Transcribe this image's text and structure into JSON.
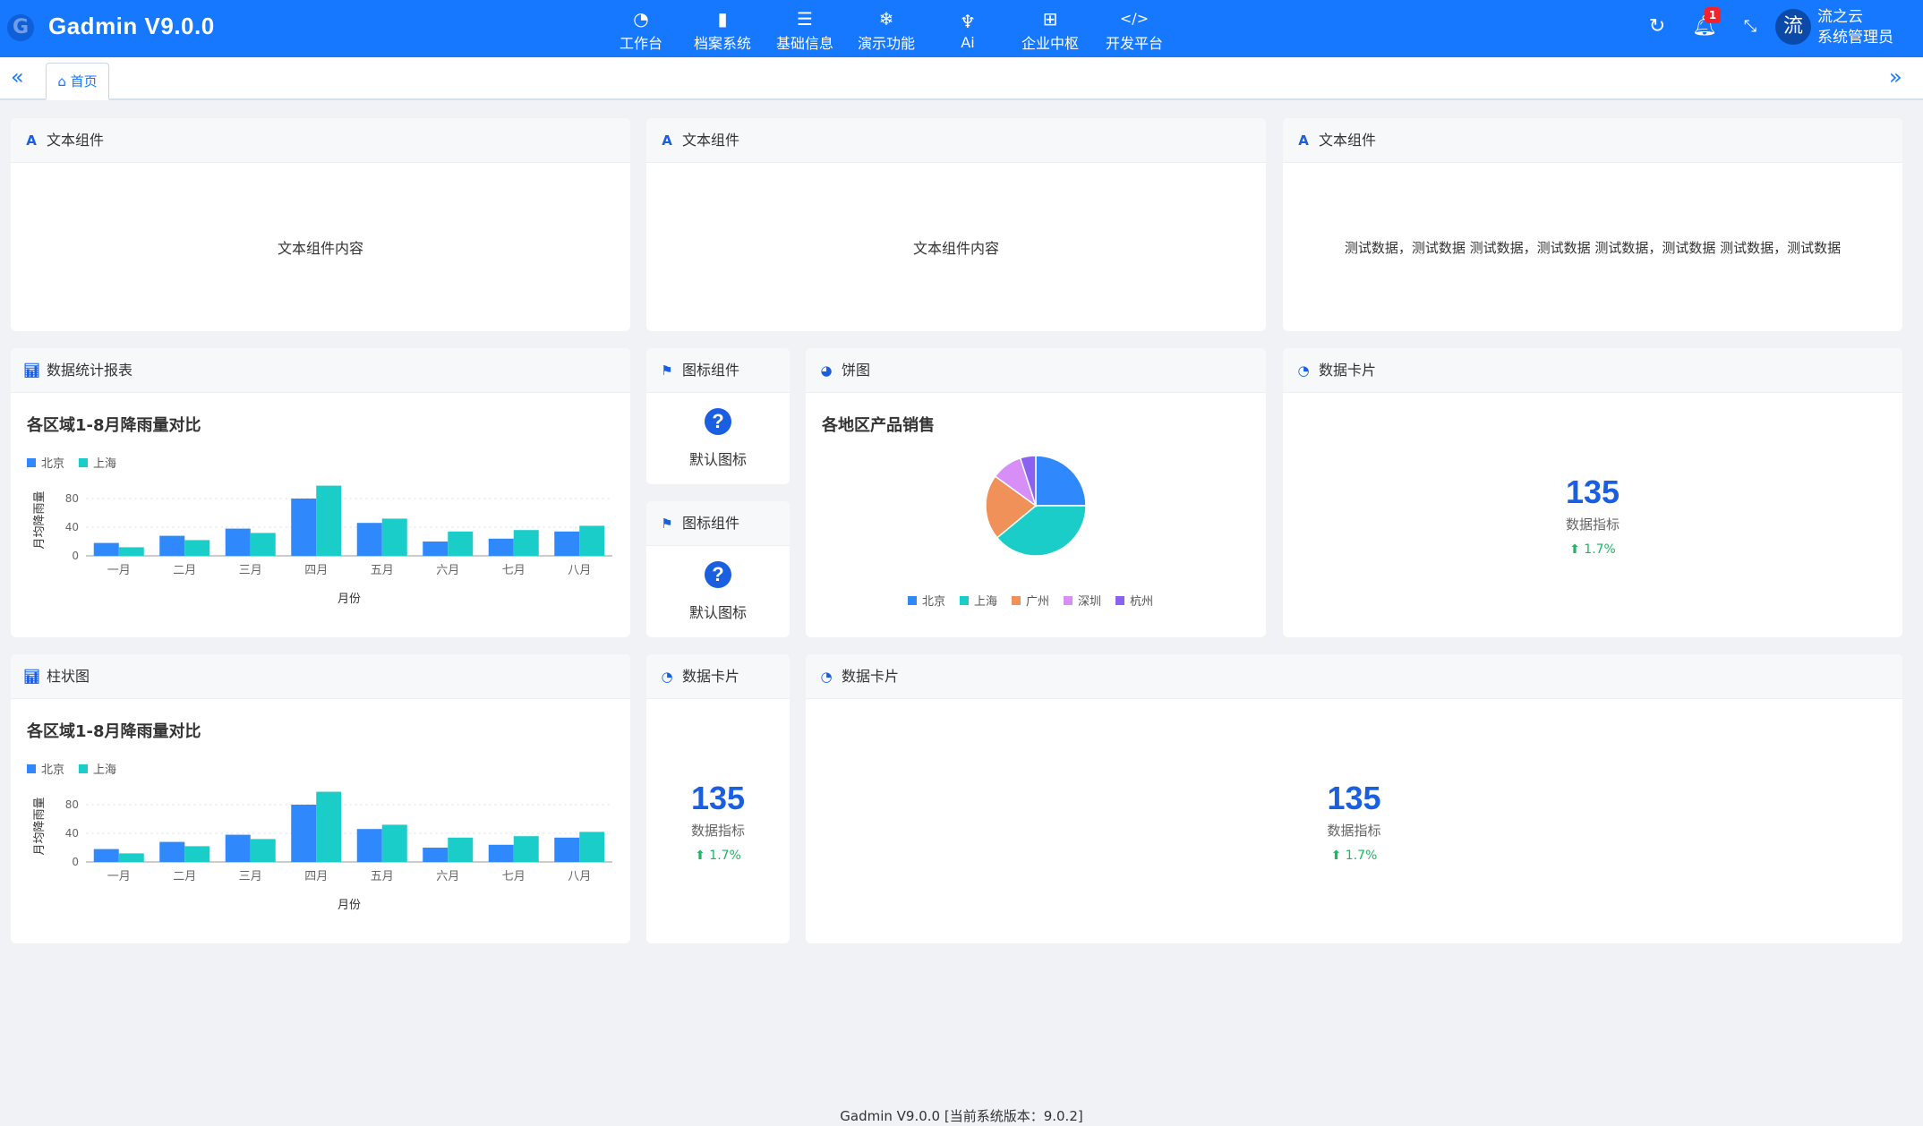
{
  "app": {
    "title": "Gadmin V9.0.0",
    "logo_icon": "gadmin-logo-icon"
  },
  "nav": [
    {
      "label": "工作台",
      "icon": "dashboard-icon",
      "glyph": "◔"
    },
    {
      "label": "档案系统",
      "icon": "bar-chart-icon",
      "glyph": "▮"
    },
    {
      "label": "基础信息",
      "icon": "list-icon",
      "glyph": "☰"
    },
    {
      "label": "演示功能",
      "icon": "snowflake-icon",
      "glyph": "❄"
    },
    {
      "label": "Ai",
      "icon": "ai-icon",
      "glyph": "♆"
    },
    {
      "label": "企业中枢",
      "icon": "apps-icon",
      "glyph": "⊞"
    },
    {
      "label": "开发平台",
      "icon": "code-icon",
      "glyph": "</>"
    }
  ],
  "header": {
    "notification_count": "1",
    "avatar_text": "流",
    "user_name": "流之云",
    "user_role": "系统管理员"
  },
  "tabs": {
    "home_label": "首页"
  },
  "text_cards": [
    {
      "title": "文本组件",
      "content": "文本组件内容"
    },
    {
      "title": "文本组件",
      "content": "文本组件内容"
    },
    {
      "title": "文本组件",
      "content": "测试数据，测试数据 测试数据，测试数据 测试数据，测试数据 测试数据，测试数据"
    }
  ],
  "report_card": {
    "title": "数据统计报表"
  },
  "bar_card": {
    "title": "柱状图"
  },
  "pie_card": {
    "title": "饼图"
  },
  "icon_cards": [
    {
      "title": "图标组件",
      "label": "默认图标",
      "icon": "question-circle-icon"
    },
    {
      "title": "图标组件",
      "label": "默认图标",
      "icon": "question-circle-icon"
    }
  ],
  "stat_cards": [
    {
      "title": "数据卡片",
      "value": "135",
      "label": "数据指标",
      "trend": "1.7%"
    },
    {
      "title": "数据卡片",
      "value": "135",
      "label": "数据指标",
      "trend": "1.7%"
    },
    {
      "title": "数据卡片",
      "value": "135",
      "label": "数据指标",
      "trend": "1.7%"
    }
  ],
  "colors": {
    "primary": "#1677ff",
    "beijing": "#2f89fc",
    "shanghai": "#1bcdc8",
    "guangzhou": "#f0915a",
    "shenzhen": "#d78ef7",
    "hangzhou": "#8b62f0",
    "trend_up": "#1fb663"
  },
  "footer": "Gadmin V9.0.0 [当前系统版本：9.0.2]",
  "chart_data": [
    {
      "type": "bar",
      "title": "各区域1-8月降雨量对比",
      "xlabel": "月份",
      "ylabel": "月均降雨量",
      "categories": [
        "一月",
        "二月",
        "三月",
        "四月",
        "五月",
        "六月",
        "七月",
        "八月"
      ],
      "ylim": [
        0,
        100
      ],
      "yticks": [
        0,
        40,
        80
      ],
      "grid": true,
      "legend": "top-left",
      "series": [
        {
          "name": "北京",
          "color": "#2f89fc",
          "values": [
            18,
            28,
            38,
            80,
            46,
            20,
            24,
            34
          ]
        },
        {
          "name": "上海",
          "color": "#1bcdc8",
          "values": [
            12,
            22,
            32,
            98,
            52,
            34,
            36,
            42
          ]
        }
      ]
    },
    {
      "type": "bar",
      "title": "各区域1-8月降雨量对比",
      "xlabel": "月份",
      "ylabel": "月均降雨量",
      "categories": [
        "一月",
        "二月",
        "三月",
        "四月",
        "五月",
        "六月",
        "七月",
        "八月"
      ],
      "ylim": [
        0,
        100
      ],
      "yticks": [
        0,
        40,
        80
      ],
      "grid": true,
      "legend": "top-left",
      "series": [
        {
          "name": "北京",
          "color": "#2f89fc",
          "values": [
            18,
            28,
            38,
            80,
            46,
            20,
            24,
            34
          ]
        },
        {
          "name": "上海",
          "color": "#1bcdc8",
          "values": [
            12,
            22,
            32,
            98,
            52,
            34,
            36,
            42
          ]
        }
      ]
    },
    {
      "type": "pie",
      "title": "各地区产品销售",
      "legend": "bottom",
      "slices": [
        {
          "name": "北京",
          "value": 25,
          "color": "#2f89fc"
        },
        {
          "name": "上海",
          "value": 39,
          "color": "#1bcdc8"
        },
        {
          "name": "广州",
          "value": 21,
          "color": "#f0915a"
        },
        {
          "name": "深圳",
          "value": 10,
          "color": "#d78ef7"
        },
        {
          "name": "杭州",
          "value": 5,
          "color": "#8b62f0"
        }
      ]
    }
  ]
}
